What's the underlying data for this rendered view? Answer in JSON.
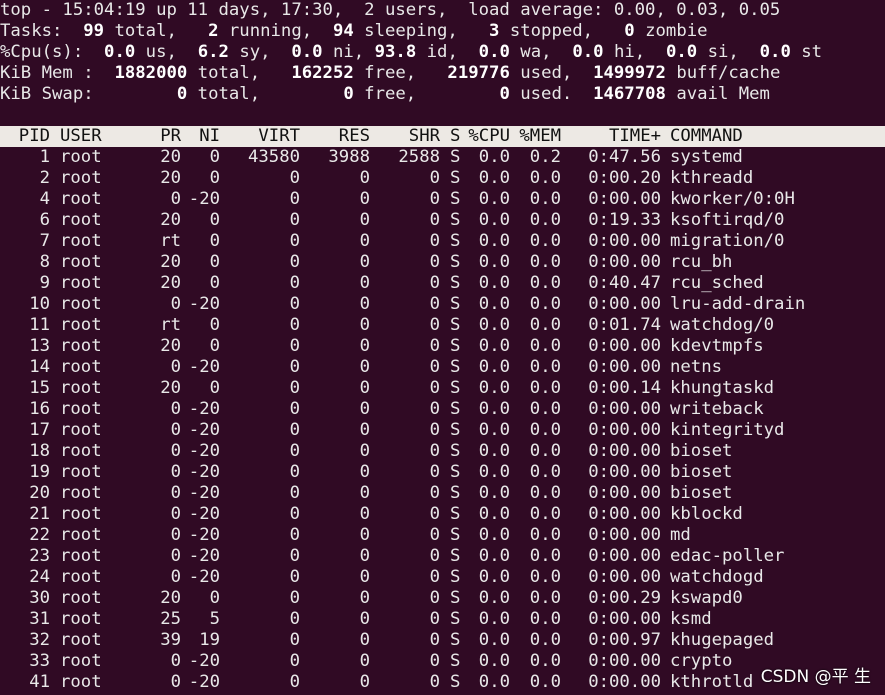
{
  "summary": {
    "l1": {
      "a": "top - 15:04:19 up 11 days, 17:30,  2 users,  load average: 0.00, 0.03, 0.05"
    },
    "l2": {
      "p0": "Tasks:  ",
      "v0": "99",
      "p1": " total,   ",
      "v1": "2",
      "p2": " running,  ",
      "v2": "94",
      "p3": " sleeping,   ",
      "v3": "3",
      "p4": " stopped,   ",
      "v4": "0",
      "p5": " zombie"
    },
    "l3": {
      "p0": "%Cpu(s):  ",
      "v0": "0.0",
      "p1": " us,  ",
      "v1": "6.2",
      "p2": " sy,  ",
      "v2": "0.0",
      "p3": " ni, ",
      "v3": "93.8",
      "p4": " id,  ",
      "v4": "0.0",
      "p5": " wa,  ",
      "v5": "0.0",
      "p6": " hi,  ",
      "v6": "0.0",
      "p7": " si,  ",
      "v7": "0.0",
      "p8": " st"
    },
    "l4": {
      "p0": "KiB Mem :  ",
      "v0": "1882000",
      "p1": " total,   ",
      "v1": "162252",
      "p2": " free,   ",
      "v2": "219776",
      "p3": " used,  ",
      "v3": "1499972",
      "p4": " buff/cache"
    },
    "l5": {
      "p0": "KiB Swap:        ",
      "v0": "0",
      "p1": " total,        ",
      "v1": "0",
      "p2": " free,        ",
      "v2": "0",
      "p3": " used.  ",
      "v3": "1467708",
      "p4": " avail Mem"
    }
  },
  "columns": [
    "PID",
    "USER",
    "PR",
    "NI",
    "VIRT",
    "RES",
    "SHR",
    "S",
    "%CPU",
    "%MEM",
    "TIME+",
    "COMMAND"
  ],
  "processes": [
    [
      "1",
      "root",
      "20",
      "0",
      "43580",
      "3988",
      "2588",
      "S",
      "0.0",
      "0.2",
      "0:47.56",
      "systemd"
    ],
    [
      "2",
      "root",
      "20",
      "0",
      "0",
      "0",
      "0",
      "S",
      "0.0",
      "0.0",
      "0:00.20",
      "kthreadd"
    ],
    [
      "4",
      "root",
      "0",
      "-20",
      "0",
      "0",
      "0",
      "S",
      "0.0",
      "0.0",
      "0:00.00",
      "kworker/0:0H"
    ],
    [
      "6",
      "root",
      "20",
      "0",
      "0",
      "0",
      "0",
      "S",
      "0.0",
      "0.0",
      "0:19.33",
      "ksoftirqd/0"
    ],
    [
      "7",
      "root",
      "rt",
      "0",
      "0",
      "0",
      "0",
      "S",
      "0.0",
      "0.0",
      "0:00.00",
      "migration/0"
    ],
    [
      "8",
      "root",
      "20",
      "0",
      "0",
      "0",
      "0",
      "S",
      "0.0",
      "0.0",
      "0:00.00",
      "rcu_bh"
    ],
    [
      "9",
      "root",
      "20",
      "0",
      "0",
      "0",
      "0",
      "S",
      "0.0",
      "0.0",
      "0:40.47",
      "rcu_sched"
    ],
    [
      "10",
      "root",
      "0",
      "-20",
      "0",
      "0",
      "0",
      "S",
      "0.0",
      "0.0",
      "0:00.00",
      "lru-add-drain"
    ],
    [
      "11",
      "root",
      "rt",
      "0",
      "0",
      "0",
      "0",
      "S",
      "0.0",
      "0.0",
      "0:01.74",
      "watchdog/0"
    ],
    [
      "13",
      "root",
      "20",
      "0",
      "0",
      "0",
      "0",
      "S",
      "0.0",
      "0.0",
      "0:00.00",
      "kdevtmpfs"
    ],
    [
      "14",
      "root",
      "0",
      "-20",
      "0",
      "0",
      "0",
      "S",
      "0.0",
      "0.0",
      "0:00.00",
      "netns"
    ],
    [
      "15",
      "root",
      "20",
      "0",
      "0",
      "0",
      "0",
      "S",
      "0.0",
      "0.0",
      "0:00.14",
      "khungtaskd"
    ],
    [
      "16",
      "root",
      "0",
      "-20",
      "0",
      "0",
      "0",
      "S",
      "0.0",
      "0.0",
      "0:00.00",
      "writeback"
    ],
    [
      "17",
      "root",
      "0",
      "-20",
      "0",
      "0",
      "0",
      "S",
      "0.0",
      "0.0",
      "0:00.00",
      "kintegrityd"
    ],
    [
      "18",
      "root",
      "0",
      "-20",
      "0",
      "0",
      "0",
      "S",
      "0.0",
      "0.0",
      "0:00.00",
      "bioset"
    ],
    [
      "19",
      "root",
      "0",
      "-20",
      "0",
      "0",
      "0",
      "S",
      "0.0",
      "0.0",
      "0:00.00",
      "bioset"
    ],
    [
      "20",
      "root",
      "0",
      "-20",
      "0",
      "0",
      "0",
      "S",
      "0.0",
      "0.0",
      "0:00.00",
      "bioset"
    ],
    [
      "21",
      "root",
      "0",
      "-20",
      "0",
      "0",
      "0",
      "S",
      "0.0",
      "0.0",
      "0:00.00",
      "kblockd"
    ],
    [
      "22",
      "root",
      "0",
      "-20",
      "0",
      "0",
      "0",
      "S",
      "0.0",
      "0.0",
      "0:00.00",
      "md"
    ],
    [
      "23",
      "root",
      "0",
      "-20",
      "0",
      "0",
      "0",
      "S",
      "0.0",
      "0.0",
      "0:00.00",
      "edac-poller"
    ],
    [
      "24",
      "root",
      "0",
      "-20",
      "0",
      "0",
      "0",
      "S",
      "0.0",
      "0.0",
      "0:00.00",
      "watchdogd"
    ],
    [
      "30",
      "root",
      "20",
      "0",
      "0",
      "0",
      "0",
      "S",
      "0.0",
      "0.0",
      "0:00.29",
      "kswapd0"
    ],
    [
      "31",
      "root",
      "25",
      "5",
      "0",
      "0",
      "0",
      "S",
      "0.0",
      "0.0",
      "0:00.00",
      "ksmd"
    ],
    [
      "32",
      "root",
      "39",
      "19",
      "0",
      "0",
      "0",
      "S",
      "0.0",
      "0.0",
      "0:00.97",
      "khugepaged"
    ],
    [
      "33",
      "root",
      "0",
      "-20",
      "0",
      "0",
      "0",
      "S",
      "0.0",
      "0.0",
      "0:00.00",
      "crypto"
    ],
    [
      "41",
      "root",
      "0",
      "-20",
      "0",
      "0",
      "0",
      "S",
      "0.0",
      "0.0",
      "0:00.00",
      "kthrotld"
    ]
  ],
  "watermark": "CSDN @平 生"
}
